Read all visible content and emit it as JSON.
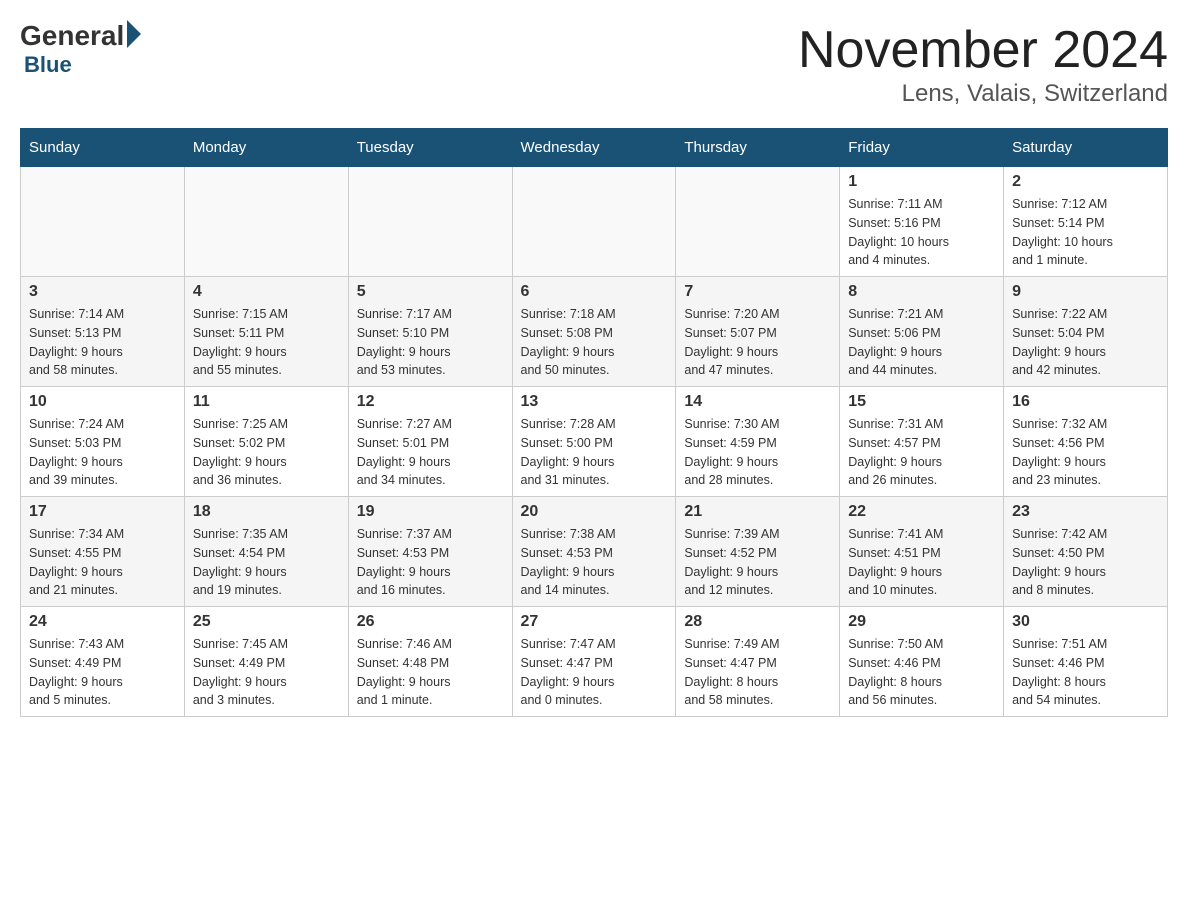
{
  "header": {
    "logo_general": "General",
    "logo_blue": "Blue",
    "title": "November 2024",
    "subtitle": "Lens, Valais, Switzerland"
  },
  "days_of_week": [
    "Sunday",
    "Monday",
    "Tuesday",
    "Wednesday",
    "Thursday",
    "Friday",
    "Saturday"
  ],
  "weeks": [
    [
      {
        "day": "",
        "info": ""
      },
      {
        "day": "",
        "info": ""
      },
      {
        "day": "",
        "info": ""
      },
      {
        "day": "",
        "info": ""
      },
      {
        "day": "",
        "info": ""
      },
      {
        "day": "1",
        "info": "Sunrise: 7:11 AM\nSunset: 5:16 PM\nDaylight: 10 hours\nand 4 minutes."
      },
      {
        "day": "2",
        "info": "Sunrise: 7:12 AM\nSunset: 5:14 PM\nDaylight: 10 hours\nand 1 minute."
      }
    ],
    [
      {
        "day": "3",
        "info": "Sunrise: 7:14 AM\nSunset: 5:13 PM\nDaylight: 9 hours\nand 58 minutes."
      },
      {
        "day": "4",
        "info": "Sunrise: 7:15 AM\nSunset: 5:11 PM\nDaylight: 9 hours\nand 55 minutes."
      },
      {
        "day": "5",
        "info": "Sunrise: 7:17 AM\nSunset: 5:10 PM\nDaylight: 9 hours\nand 53 minutes."
      },
      {
        "day": "6",
        "info": "Sunrise: 7:18 AM\nSunset: 5:08 PM\nDaylight: 9 hours\nand 50 minutes."
      },
      {
        "day": "7",
        "info": "Sunrise: 7:20 AM\nSunset: 5:07 PM\nDaylight: 9 hours\nand 47 minutes."
      },
      {
        "day": "8",
        "info": "Sunrise: 7:21 AM\nSunset: 5:06 PM\nDaylight: 9 hours\nand 44 minutes."
      },
      {
        "day": "9",
        "info": "Sunrise: 7:22 AM\nSunset: 5:04 PM\nDaylight: 9 hours\nand 42 minutes."
      }
    ],
    [
      {
        "day": "10",
        "info": "Sunrise: 7:24 AM\nSunset: 5:03 PM\nDaylight: 9 hours\nand 39 minutes."
      },
      {
        "day": "11",
        "info": "Sunrise: 7:25 AM\nSunset: 5:02 PM\nDaylight: 9 hours\nand 36 minutes."
      },
      {
        "day": "12",
        "info": "Sunrise: 7:27 AM\nSunset: 5:01 PM\nDaylight: 9 hours\nand 34 minutes."
      },
      {
        "day": "13",
        "info": "Sunrise: 7:28 AM\nSunset: 5:00 PM\nDaylight: 9 hours\nand 31 minutes."
      },
      {
        "day": "14",
        "info": "Sunrise: 7:30 AM\nSunset: 4:59 PM\nDaylight: 9 hours\nand 28 minutes."
      },
      {
        "day": "15",
        "info": "Sunrise: 7:31 AM\nSunset: 4:57 PM\nDaylight: 9 hours\nand 26 minutes."
      },
      {
        "day": "16",
        "info": "Sunrise: 7:32 AM\nSunset: 4:56 PM\nDaylight: 9 hours\nand 23 minutes."
      }
    ],
    [
      {
        "day": "17",
        "info": "Sunrise: 7:34 AM\nSunset: 4:55 PM\nDaylight: 9 hours\nand 21 minutes."
      },
      {
        "day": "18",
        "info": "Sunrise: 7:35 AM\nSunset: 4:54 PM\nDaylight: 9 hours\nand 19 minutes."
      },
      {
        "day": "19",
        "info": "Sunrise: 7:37 AM\nSunset: 4:53 PM\nDaylight: 9 hours\nand 16 minutes."
      },
      {
        "day": "20",
        "info": "Sunrise: 7:38 AM\nSunset: 4:53 PM\nDaylight: 9 hours\nand 14 minutes."
      },
      {
        "day": "21",
        "info": "Sunrise: 7:39 AM\nSunset: 4:52 PM\nDaylight: 9 hours\nand 12 minutes."
      },
      {
        "day": "22",
        "info": "Sunrise: 7:41 AM\nSunset: 4:51 PM\nDaylight: 9 hours\nand 10 minutes."
      },
      {
        "day": "23",
        "info": "Sunrise: 7:42 AM\nSunset: 4:50 PM\nDaylight: 9 hours\nand 8 minutes."
      }
    ],
    [
      {
        "day": "24",
        "info": "Sunrise: 7:43 AM\nSunset: 4:49 PM\nDaylight: 9 hours\nand 5 minutes."
      },
      {
        "day": "25",
        "info": "Sunrise: 7:45 AM\nSunset: 4:49 PM\nDaylight: 9 hours\nand 3 minutes."
      },
      {
        "day": "26",
        "info": "Sunrise: 7:46 AM\nSunset: 4:48 PM\nDaylight: 9 hours\nand 1 minute."
      },
      {
        "day": "27",
        "info": "Sunrise: 7:47 AM\nSunset: 4:47 PM\nDaylight: 9 hours\nand 0 minutes."
      },
      {
        "day": "28",
        "info": "Sunrise: 7:49 AM\nSunset: 4:47 PM\nDaylight: 8 hours\nand 58 minutes."
      },
      {
        "day": "29",
        "info": "Sunrise: 7:50 AM\nSunset: 4:46 PM\nDaylight: 8 hours\nand 56 minutes."
      },
      {
        "day": "30",
        "info": "Sunrise: 7:51 AM\nSunset: 4:46 PM\nDaylight: 8 hours\nand 54 minutes."
      }
    ]
  ]
}
